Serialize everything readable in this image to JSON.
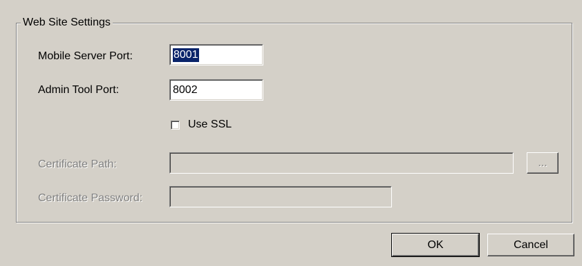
{
  "group": {
    "title": "Web Site Settings"
  },
  "fields": {
    "mobile_server_port": {
      "label": "Mobile Server Port:",
      "value": "8001"
    },
    "admin_tool_port": {
      "label": "Admin Tool Port:",
      "value": "8002"
    },
    "use_ssl": {
      "label": "Use SSL",
      "checked": false
    },
    "certificate_path": {
      "label": "Certificate Path:",
      "value": "",
      "enabled": false
    },
    "certificate_password": {
      "label": "Certificate Password:",
      "value": "",
      "enabled": false
    }
  },
  "buttons": {
    "browse": "...",
    "ok": "OK",
    "cancel": "Cancel"
  },
  "colors": {
    "background": "#d4d0c8",
    "selection": "#0a246a",
    "disabled_text": "#808080"
  }
}
